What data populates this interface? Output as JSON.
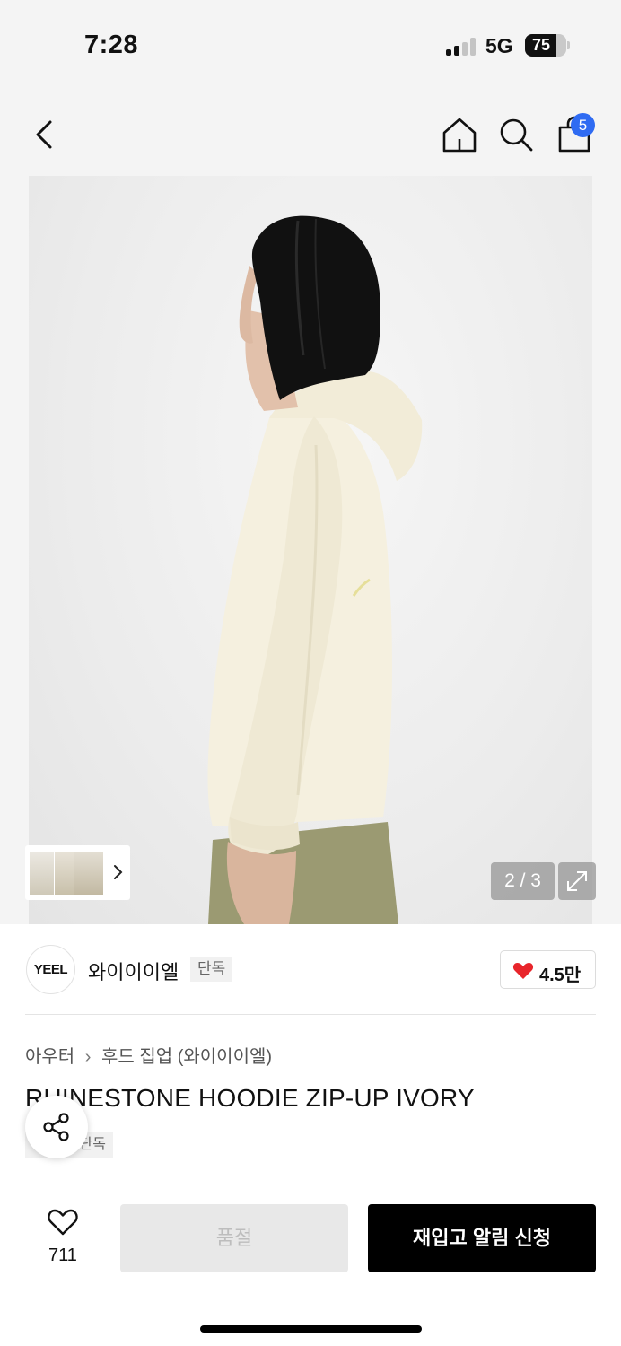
{
  "status_bar": {
    "time": "7:28",
    "network": "5G",
    "battery": "75",
    "battery_level": 0.75
  },
  "nav": {
    "icons": [
      "back-chevron-icon",
      "home-icon",
      "search-icon",
      "shopping-bag-icon"
    ],
    "cart_count": "5",
    "badge_color": "#2f6bf2"
  },
  "gallery": {
    "counter": "2 / 3",
    "expand_icon": "expand-arrows-icon"
  },
  "brand": {
    "logo_text": "YEEL",
    "name": "와이이이엘",
    "badge": "단독",
    "like_count": "4.5만",
    "heart_color": "#e8252b"
  },
  "product": {
    "breadcrumb": [
      "아우터",
      "후드 집업 (와이이이엘)"
    ],
    "title": "RHINESTONE HOODIE ZIP-UP IVORY",
    "tag": "단독"
  },
  "actions": {
    "wish_count": "711",
    "soldout_label": "품절",
    "restock_label": "재입고 알림 신청"
  }
}
